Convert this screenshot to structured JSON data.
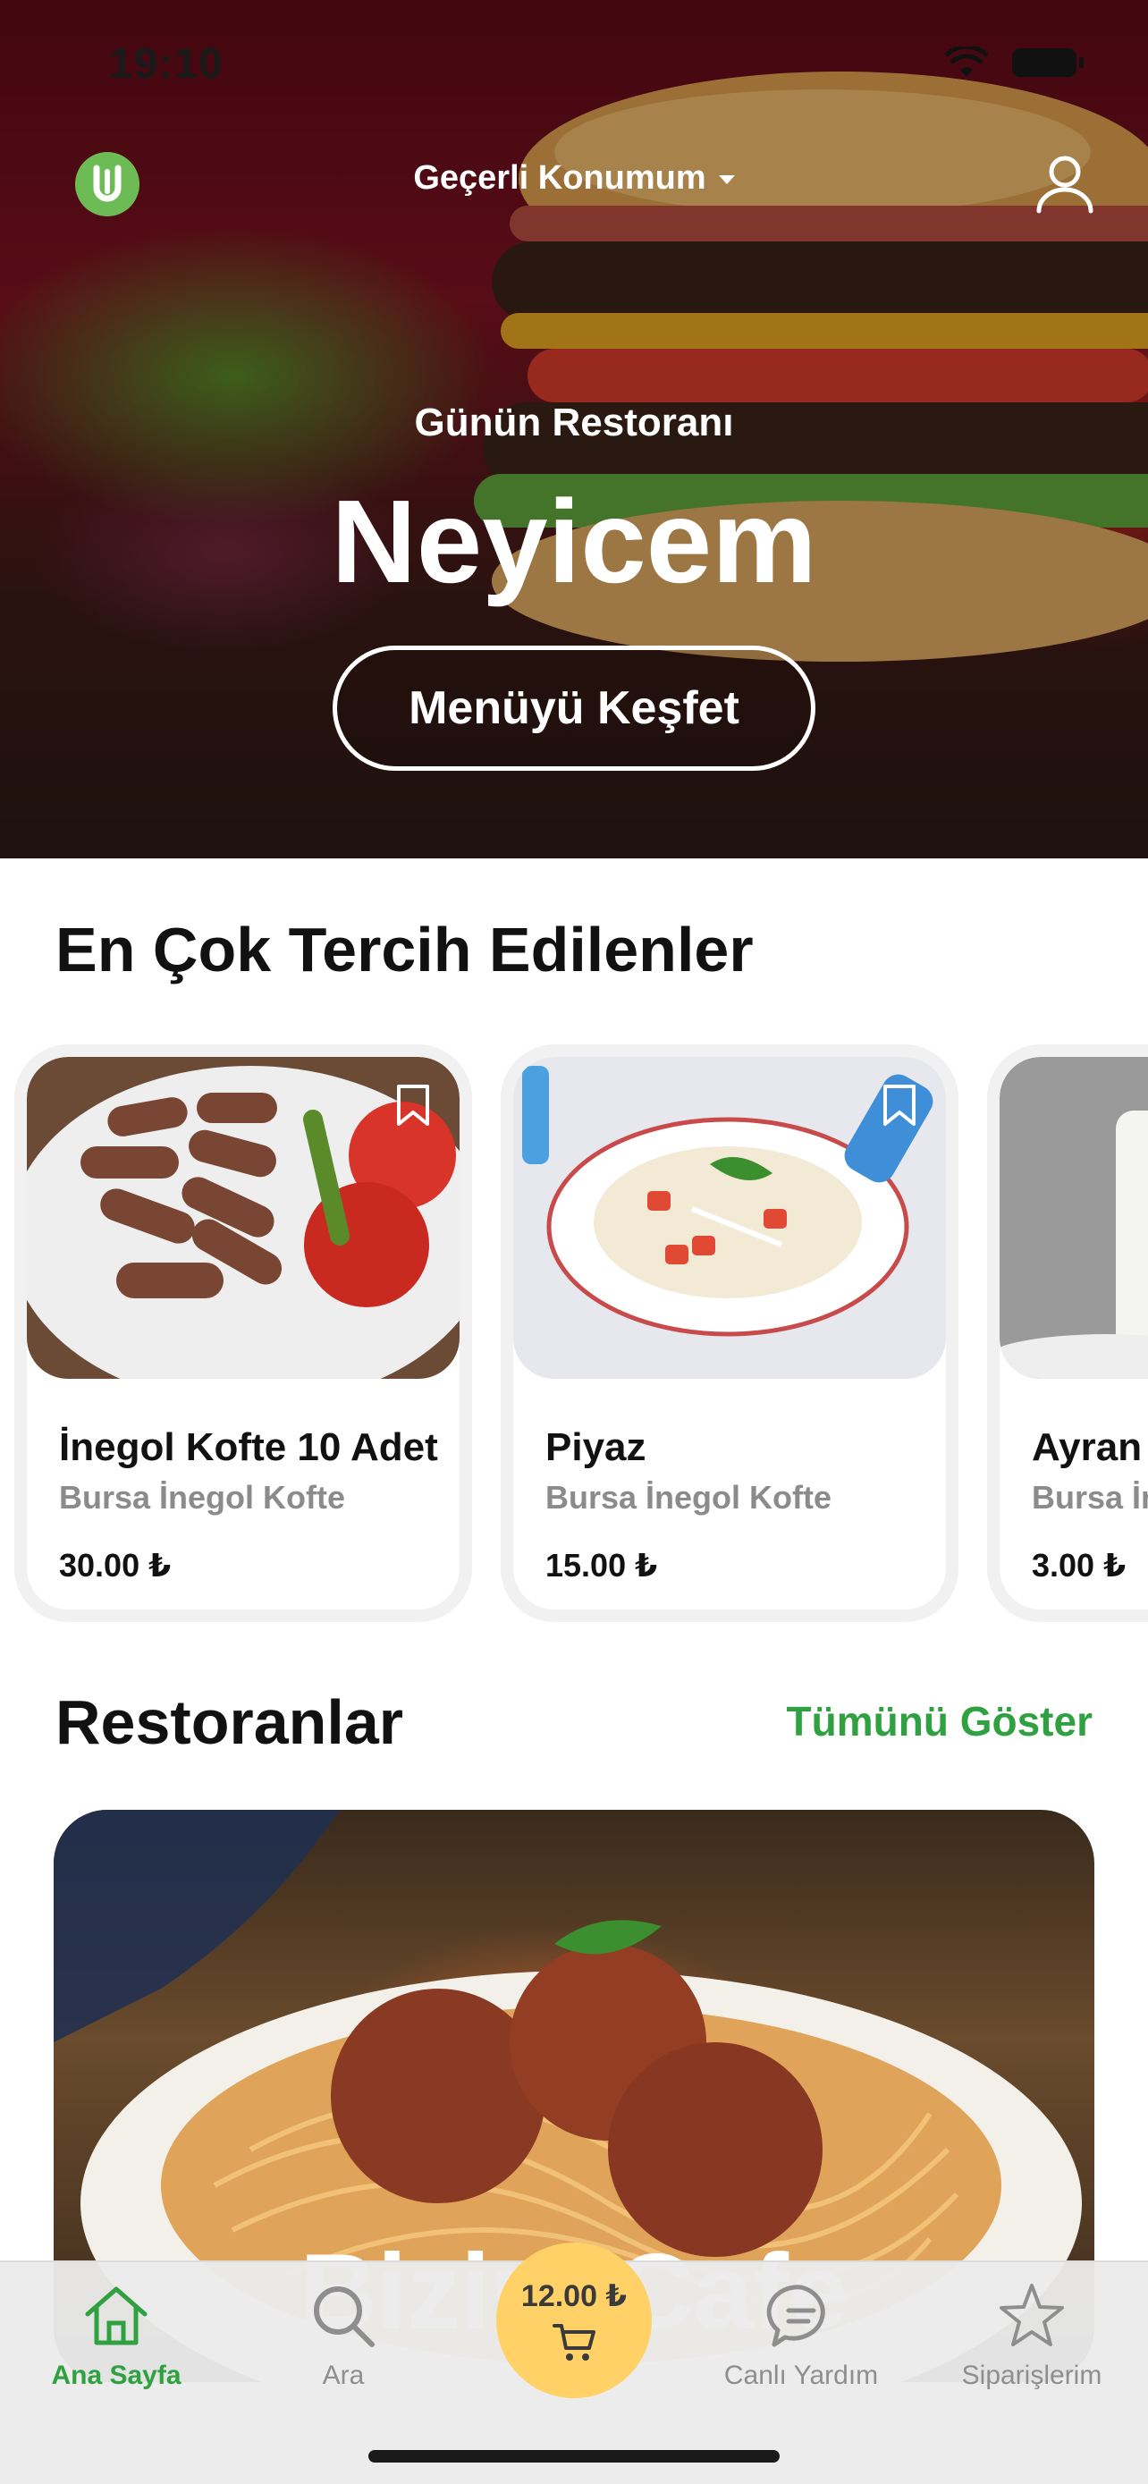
{
  "status_bar": {
    "time": "19:10"
  },
  "header": {
    "location_label": "Geçerli Konumum"
  },
  "hero": {
    "subtitle": "Günün Restoranı",
    "restaurant_name": "Neyicem",
    "cta_label": "Menüyü Keşfet"
  },
  "popular": {
    "title": "En Çok Tercih Edilenler",
    "items": [
      {
        "name": "İnegol Kofte  10 Adet",
        "restaurant": "Bursa İnegol Kofte",
        "price": "30.00 ₺"
      },
      {
        "name": "Piyaz",
        "restaurant": "Bursa İnegol Kofte",
        "price": "15.00 ₺"
      },
      {
        "name": "Ayran",
        "restaurant": "Bursa İnegol Kofte",
        "price": "3.00 ₺"
      }
    ]
  },
  "restaurants": {
    "title": "Restoranlar",
    "see_all_label": "Tümünü Göster",
    "items": [
      {
        "name": "Bizim Cafe"
      }
    ]
  },
  "tabbar": {
    "home_label": "Ana Sayfa",
    "search_label": "Ara",
    "cart_total": "12.00 ₺",
    "support_label": "Canlı Yardım",
    "orders_label": "Siparişlerim"
  },
  "colors": {
    "accent_green": "#2fa140",
    "cart_yellow": "#ffd166",
    "brand_green": "#6dbb55"
  },
  "icons": [
    "wifi-icon",
    "battery-icon",
    "brand-logo-icon",
    "caret-down-icon",
    "user-icon",
    "bookmark-icon",
    "home-icon",
    "search-icon",
    "cart-icon",
    "chat-icon",
    "star-icon"
  ]
}
